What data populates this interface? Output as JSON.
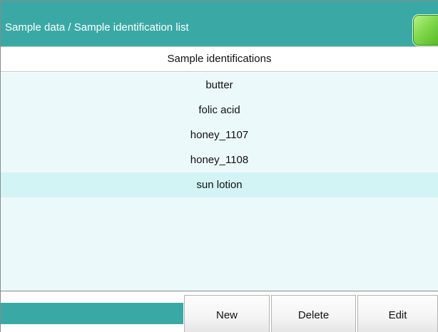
{
  "title_bar": {
    "title": "Sample data / Sample identification list",
    "status_color": "#7fd648"
  },
  "table": {
    "header": "Sample identifications",
    "rows": [
      "butter",
      "folic acid",
      "honey_1107",
      "honey_1108",
      "sun lotion"
    ],
    "selected_index": 4
  },
  "buttons": {
    "new": "New",
    "delete": "Delete",
    "edit": "Edit"
  },
  "colors": {
    "title_bar": "#3aa9a5",
    "list_background": "#ecf9fb",
    "selected_row": "#d2f4f5"
  }
}
